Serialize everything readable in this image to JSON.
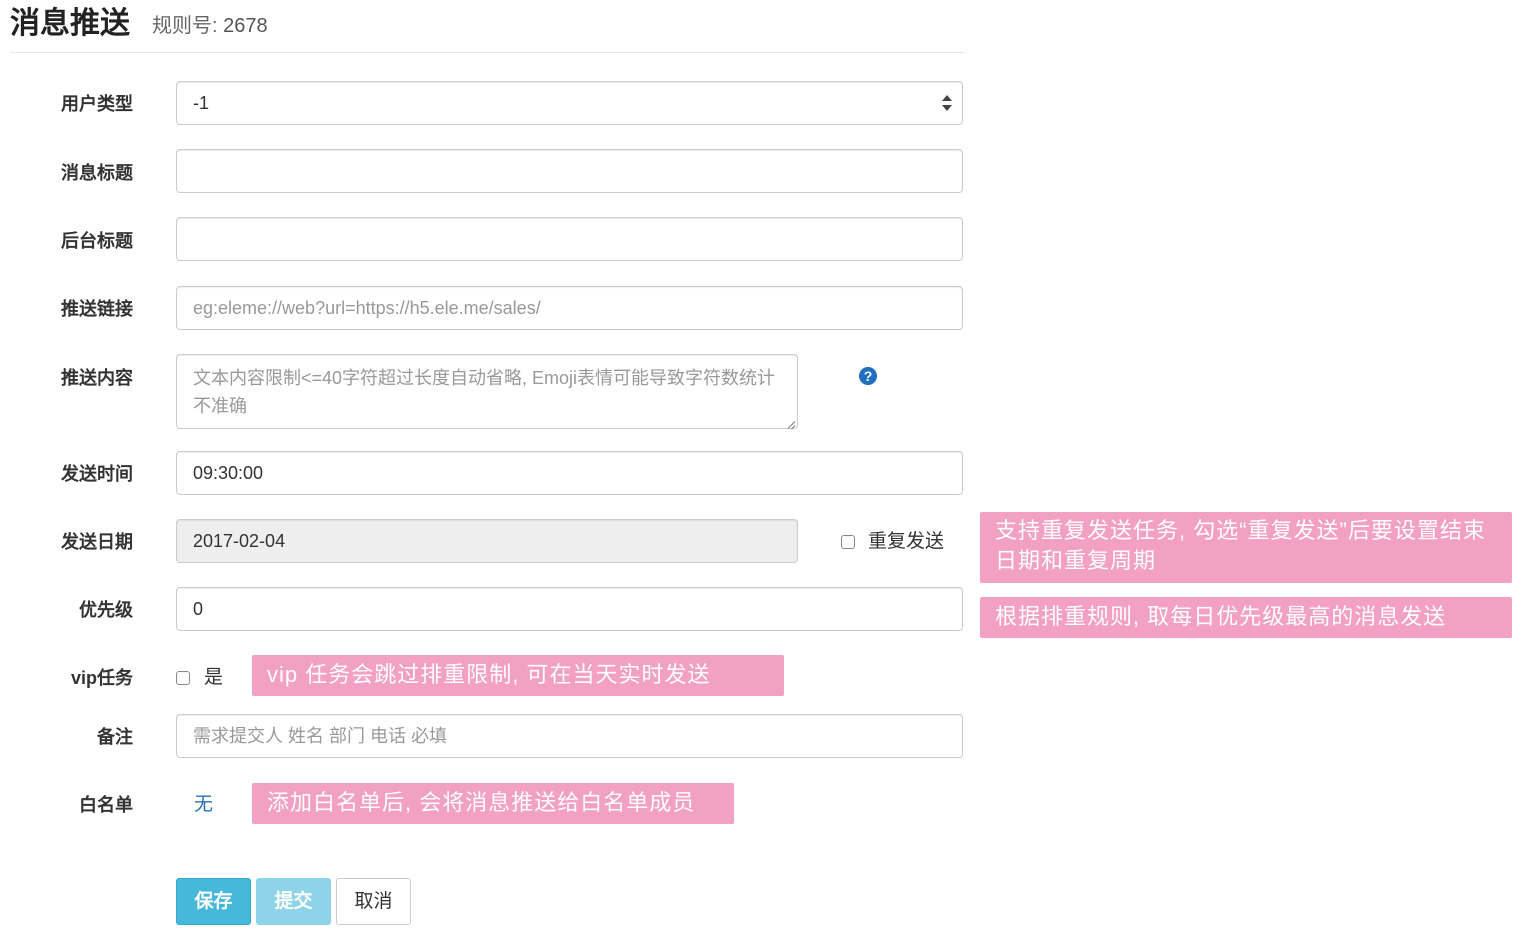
{
  "header": {
    "title": "消息推送",
    "subtitle_label": "规则号:",
    "rule_number": "2678"
  },
  "form": {
    "user_type": {
      "label": "用户类型",
      "value": "-1"
    },
    "message_title": {
      "label": "消息标题",
      "value": ""
    },
    "backend_title": {
      "label": "后台标题",
      "value": ""
    },
    "push_link": {
      "label": "推送链接",
      "placeholder": "eg:eleme://web?url=https://h5.ele.me/sales/"
    },
    "push_content": {
      "label": "推送内容",
      "placeholder": "文本内容限制<=40字符超过长度自动省略, Emoji表情可能导致字符数统计不准确",
      "help_icon": "question-circle-icon"
    },
    "send_time": {
      "label": "发送时间",
      "value": "09:30:00"
    },
    "send_date": {
      "label": "发送日期",
      "value": "2017-02-04",
      "repeat_label": "重复发送"
    },
    "priority": {
      "label": "优先级",
      "value": "0"
    },
    "vip_task": {
      "label": "vip任务",
      "checkbox_label": "是"
    },
    "remark": {
      "label": "备注",
      "placeholder": "需求提交人 姓名 部门 电话 必填"
    },
    "whitelist": {
      "label": "白名单",
      "value": "无"
    }
  },
  "notes": {
    "repeat": "支持重复发送任务, 勾选“重复发送”后要设置结束日期和重复周期",
    "priority": "根据排重规则, 取每日优先级最高的消息发送",
    "vip": "vip 任务会跳过排重限制, 可在当天实时发送",
    "whitelist": "添加白名单后, 会将消息推送给白名单成员"
  },
  "buttons": {
    "save": "保存",
    "submit": "提交",
    "cancel": "取消"
  },
  "colors": {
    "note_bg": "#f2a0c3",
    "primary": "#46b8da",
    "primary_disabled": "#8fd3e8",
    "link": "#2a6fb5"
  }
}
